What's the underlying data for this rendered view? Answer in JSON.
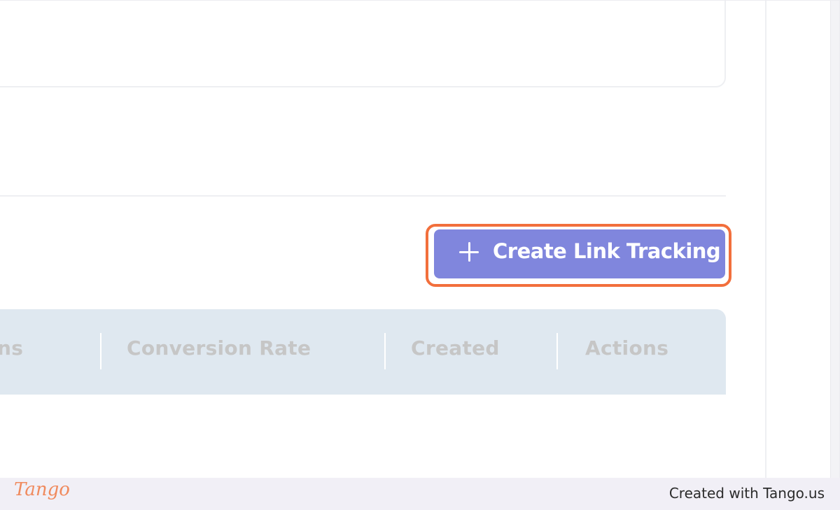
{
  "toolbar": {
    "create_button_label": "Create Link Tracking",
    "create_button_icon": "plus-icon"
  },
  "table": {
    "columns": [
      "ns",
      "Conversion Rate",
      "Created",
      "Actions"
    ]
  },
  "footer": {
    "logo_text": "Tango",
    "credit_text": "Created with Tango.us"
  },
  "colors": {
    "button_bg": "#8086dd",
    "highlight": "#f26f3c",
    "header_bg": "#dfe8f0"
  }
}
